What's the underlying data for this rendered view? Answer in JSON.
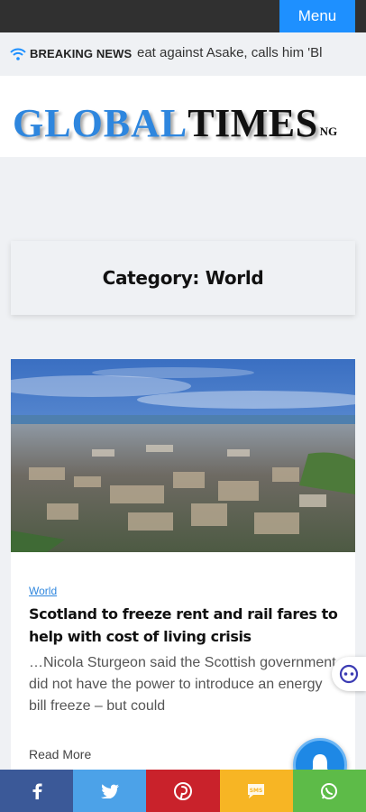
{
  "header": {
    "menu_label": "Menu"
  },
  "ticker": {
    "label": "BREAKING NEWS",
    "text": "eat against Asake, calls him 'Bl"
  },
  "logo": {
    "part1": "GLOBAL",
    "part2": "TIMES",
    "suffix": "NG"
  },
  "category": {
    "title": "Category: World"
  },
  "article": {
    "tag": "World",
    "headline": "Scotland to freeze rent and rail fares to help with cost of living crisis",
    "excerpt": "…Nicola Sturgeon said the Scottish government did not have the power to introduce an energy bill freeze – but could",
    "read_more": "Read More"
  },
  "share": {
    "icons": [
      "facebook-icon",
      "twitter-icon",
      "pinterest-icon",
      "sms-icon",
      "whatsapp-icon"
    ],
    "sms_label": "SMS"
  },
  "colors": {
    "accent": "#1e90ff",
    "topbar": "#303030",
    "facebook": "#3b5998",
    "twitter": "#4ca2e8",
    "pinterest": "#c9222b",
    "sms": "#f7b524",
    "whatsapp": "#5dbb48"
  }
}
